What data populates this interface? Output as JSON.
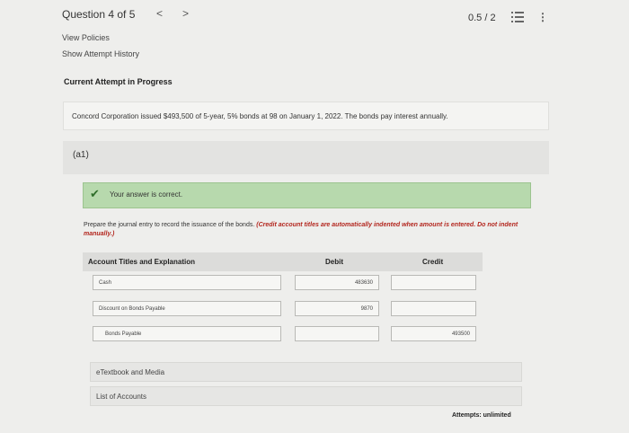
{
  "header": {
    "question_label": "Question 4 of 5",
    "prev_arrow": "<",
    "next_arrow": ">",
    "score": "0.5 / 2",
    "more_glyph": "⋮"
  },
  "links": {
    "view_policies": "View Policies",
    "attempt_history": "Show Attempt History"
  },
  "current_attempt": "Current Attempt in Progress",
  "problem": "Concord Corporation issued $493,500 of 5-year, 5% bonds at 98 on January 1, 2022. The bonds pay interest annually.",
  "part": {
    "label": "(a1)",
    "feedback": "Your answer is correct.",
    "check_glyph": "✔",
    "instruction": "Prepare the journal entry to record the issuance of the bonds.",
    "instruction_note": "(Credit account titles are automatically indented when amount is entered. Do not indent manually.)"
  },
  "table": {
    "headers": {
      "account": "Account Titles and Explanation",
      "debit": "Debit",
      "credit": "Credit"
    },
    "rows": [
      {
        "account": "Cash",
        "debit": "483630",
        "credit": ""
      },
      {
        "account": "Discount on Bonds Payable",
        "debit": "9870",
        "credit": ""
      },
      {
        "account": "Bonds Payable",
        "debit": "",
        "credit": "493500"
      }
    ]
  },
  "resources": {
    "etextbook": "eTextbook and Media",
    "accounts": "List of Accounts"
  },
  "attempts": "Attempts: unlimited"
}
